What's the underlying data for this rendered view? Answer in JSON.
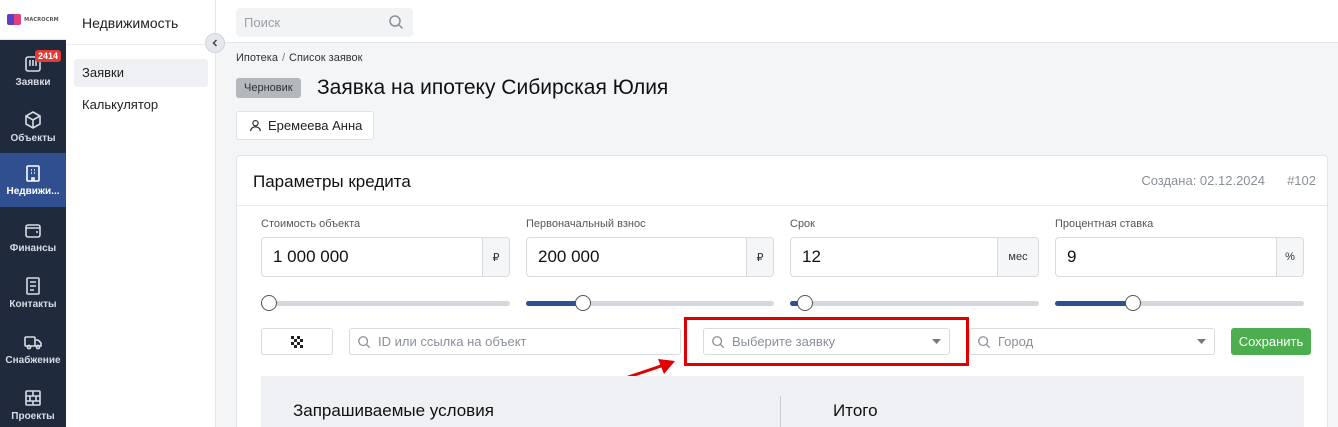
{
  "brand": {
    "logo_text": "MACROCRM"
  },
  "rail": {
    "items": [
      {
        "label": "Заявки",
        "badge": "2414"
      },
      {
        "label": "Объекты"
      },
      {
        "label": "Недвижи..."
      },
      {
        "label": "Финансы"
      },
      {
        "label": "Контакты"
      },
      {
        "label": "Снабжение"
      },
      {
        "label": "Проекты"
      }
    ]
  },
  "sidebar": {
    "title": "Недвижимость",
    "items": [
      {
        "label": "Заявки"
      },
      {
        "label": "Калькулятор"
      }
    ]
  },
  "topbar": {
    "search_placeholder": "Поиск"
  },
  "breadcrumb": {
    "parent": "Ипотека",
    "sep": "/",
    "current": "Список заявок"
  },
  "page": {
    "status": "Черновик",
    "title": "Заявка на ипотеку Сибирская Юлия",
    "manager": "Еремеева Анна"
  },
  "card": {
    "title": "Параметры кредита",
    "created": "Создана: 02.12.2024",
    "number": "#102",
    "fields": [
      {
        "label": "Стоимость объекта",
        "value": "1 000 000",
        "unit": "₽",
        "slider_percent": 0
      },
      {
        "label": "Первоначальный взнос",
        "value": "200 000",
        "unit": "₽",
        "slider_percent": 21
      },
      {
        "label": "Срок",
        "value": "12",
        "unit": "мес",
        "slider_percent": 3
      },
      {
        "label": "Процентная ставка",
        "value": "9",
        "unit": "%",
        "slider_percent": 30
      }
    ],
    "object_search_placeholder": "ID или ссылка на объект",
    "request_select_placeholder": "Выберите заявку",
    "city_select_placeholder": "Город",
    "save_label": "Сохранить",
    "requested_title": "Запрашиваемые условия",
    "total_title": "Итого"
  },
  "colors": {
    "rail_bg": "#1f2a3d",
    "rail_active": "#2f4f8f",
    "accent": "#2f4f8f",
    "save": "#4cae4f",
    "badge": "#e53935",
    "highlight": "#e00000"
  }
}
